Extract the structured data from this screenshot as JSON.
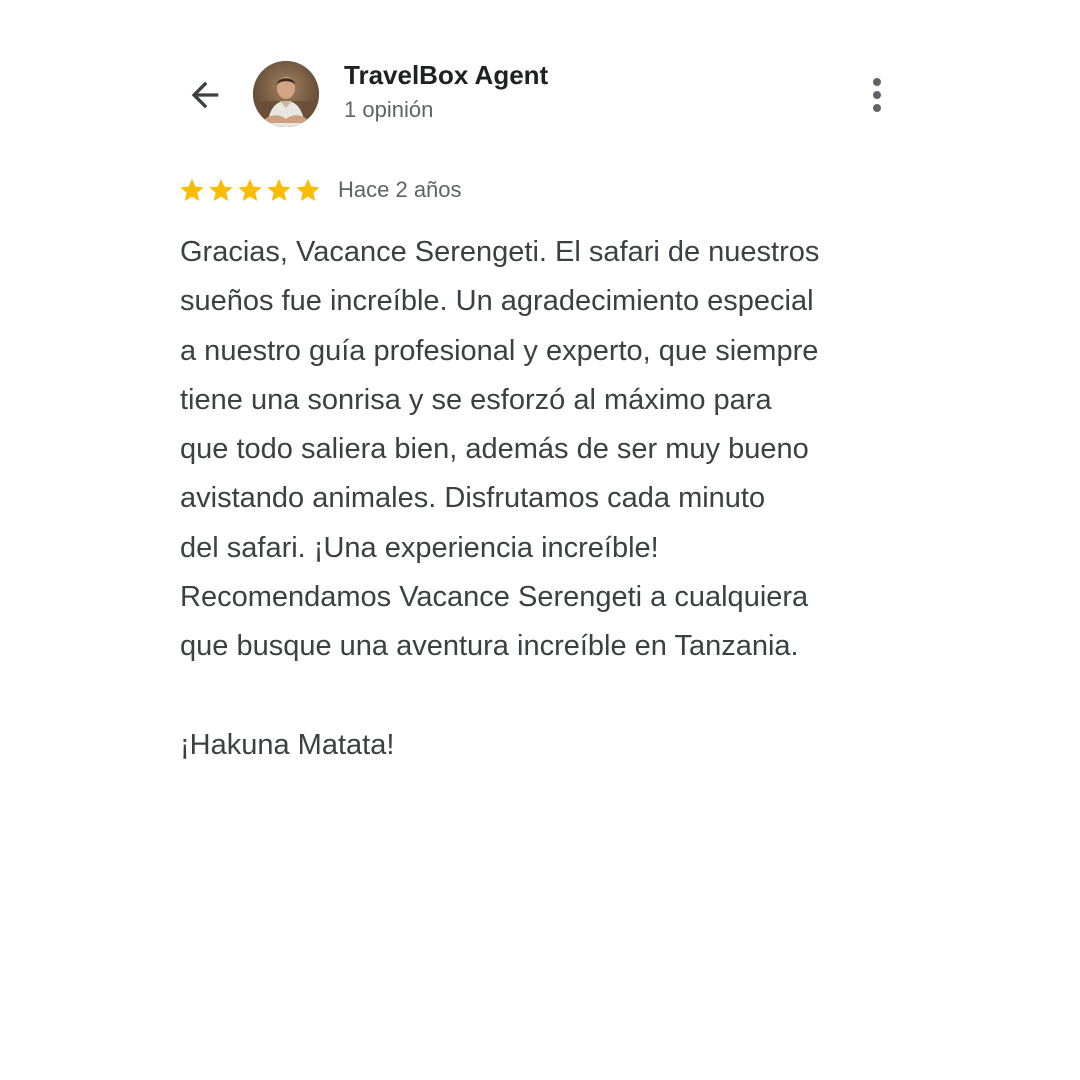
{
  "header": {
    "back_icon": "arrow-back-icon",
    "avatar_icon": "reviewer-avatar-photo",
    "reviewer_name": "TravelBox Agent",
    "review_count": "1 opinión",
    "more_icon": "more-vert-icon"
  },
  "rating": {
    "stars": 5,
    "max_stars": 5,
    "star_color": "#fbbc04",
    "date": "Hace 2 años"
  },
  "review": {
    "lines": [
      "Gracias, Vacance Serengeti. El safari de nuestros",
      "sueños fue increíble. Un agradecimiento especial",
      "a nuestro guía profesional y experto, que siempre",
      "tiene una sonrisa y se esforzó al máximo para",
      "que todo saliera bien, además de ser muy bueno",
      "avistando animales. Disfrutamos cada minuto",
      "del safari. ¡Una experiencia increíble!",
      "Recomendamos Vacance Serengeti a cualquiera",
      "que busque una aventura increíble en Tanzania."
    ],
    "closing": "¡Hakuna Matata!"
  }
}
